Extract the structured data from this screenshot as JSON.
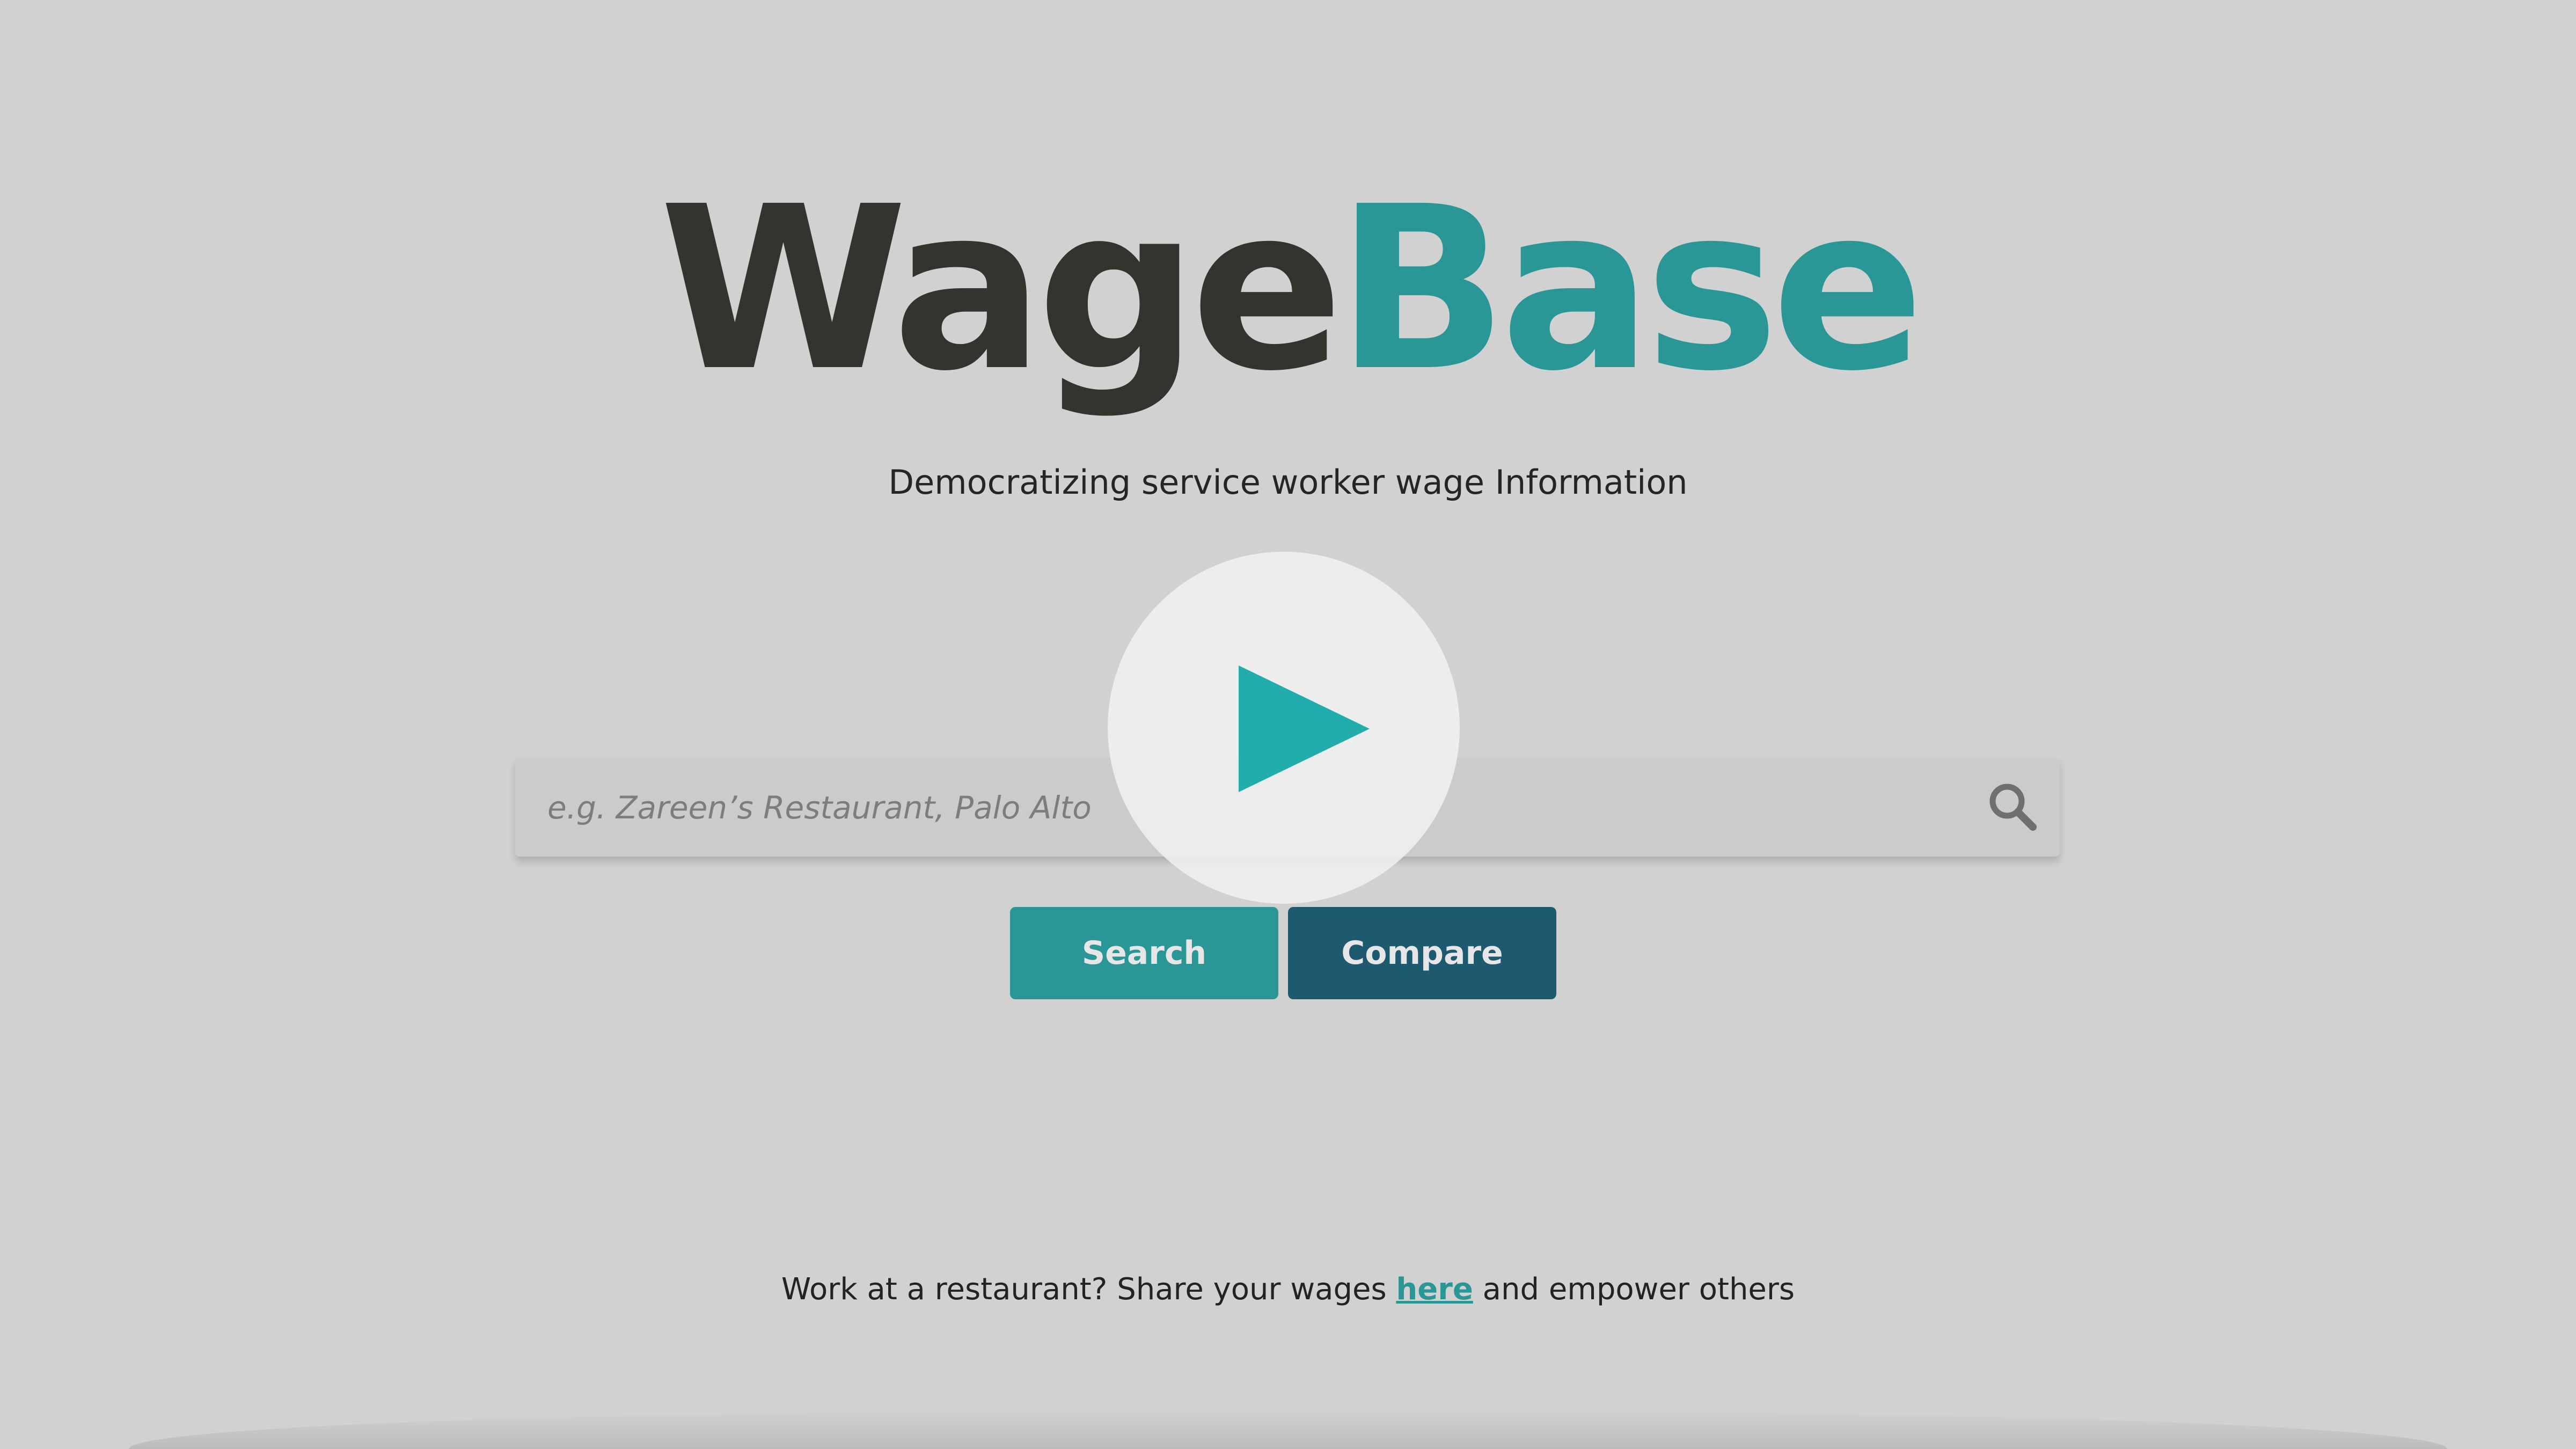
{
  "logo": {
    "part1": "Wage",
    "part2": "Base",
    "color_part1": "#33342d",
    "color_part2": "#2a9696"
  },
  "tagline": "Democratizing service worker wage Information",
  "search": {
    "placeholder": "e.g. Zareen’s Restaurant, Palo Alto",
    "value": "",
    "icon": "search-icon"
  },
  "buttons": {
    "search_label": "Search",
    "compare_label": "Compare",
    "search_color": "#2a9696",
    "compare_color": "#1e5a6f"
  },
  "play_overlay": {
    "icon": "play-icon",
    "color": "#23acac"
  },
  "footer": {
    "text_before": "Work at a restaurant? Share your wages ",
    "link_label": "here",
    "text_after": " and empower others"
  }
}
